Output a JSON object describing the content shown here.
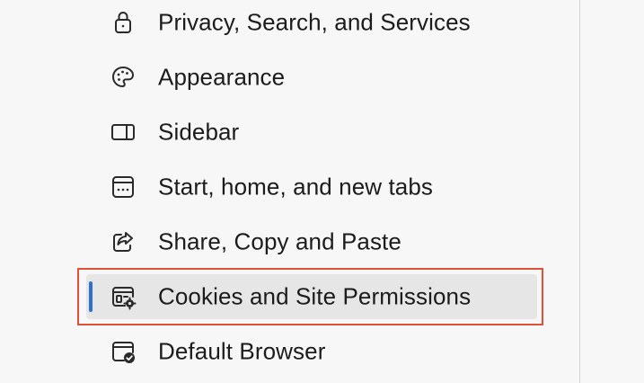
{
  "sidebar": {
    "items": [
      {
        "label": "Privacy, Search, and Services",
        "icon": "lock-icon"
      },
      {
        "label": "Appearance",
        "icon": "palette-icon"
      },
      {
        "label": "Sidebar",
        "icon": "sidebar-icon"
      },
      {
        "label": "Start, home, and new tabs",
        "icon": "home-tabs-icon"
      },
      {
        "label": "Share, Copy and Paste",
        "icon": "share-icon"
      },
      {
        "label": "Cookies and Site Permissions",
        "icon": "cookies-settings-icon",
        "selected": true
      },
      {
        "label": "Default Browser",
        "icon": "default-browser-icon"
      }
    ]
  },
  "colors": {
    "selection_accent": "#2f6fd1",
    "highlight_border": "#e0513a",
    "selected_background": "#e6e6e6"
  }
}
